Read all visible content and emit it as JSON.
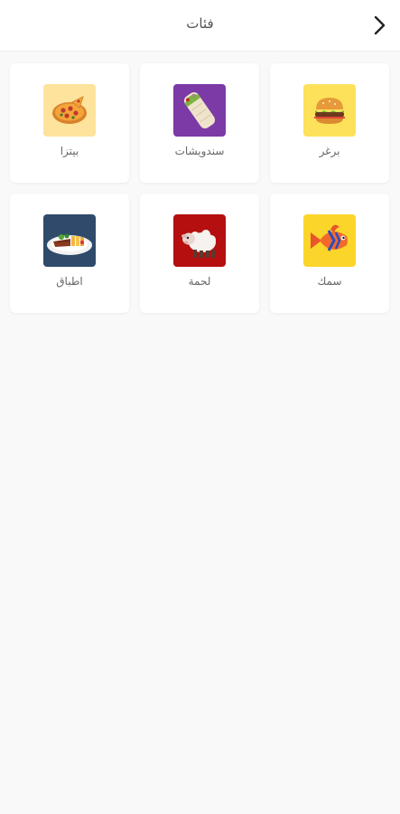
{
  "header": {
    "title": "فئات"
  },
  "categories": [
    {
      "label": "برغر",
      "icon": "burger-icon",
      "bg": "#fde15a"
    },
    {
      "label": "سندويشات",
      "icon": "wrap-sandwich-icon",
      "bg": "#7b3aa6"
    },
    {
      "label": "بيتزا",
      "icon": "pizza-icon",
      "bg": "#fde39b"
    },
    {
      "label": "سمك",
      "icon": "fish-icon",
      "bg": "#fcd52a"
    },
    {
      "label": "لحمة",
      "icon": "sheep-icon",
      "bg": "#b50f0f"
    },
    {
      "label": "اطباق",
      "icon": "plate-dish-icon",
      "bg": "#2f4a6b"
    }
  ]
}
